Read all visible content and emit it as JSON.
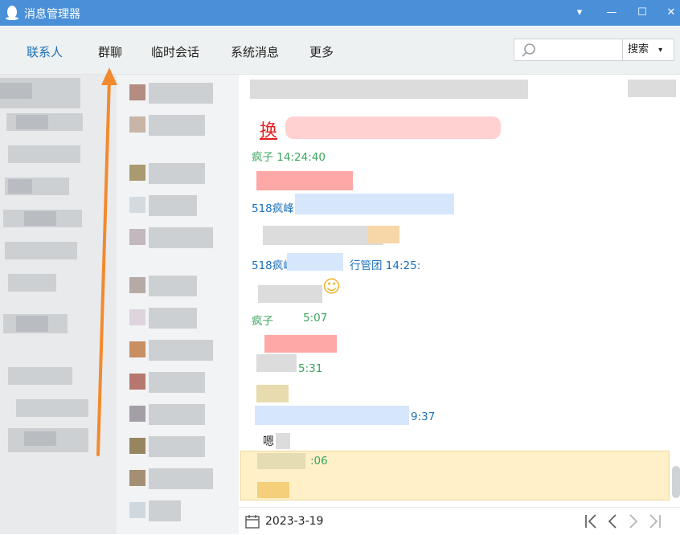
{
  "titlebar": {
    "title": "消息管理器",
    "minimize": "—",
    "maximize": "☐",
    "close": "✕",
    "menu": "▾"
  },
  "tabs": [
    {
      "label": "联系人"
    },
    {
      "label": "群聊"
    },
    {
      "label": "临时会话"
    },
    {
      "label": "系统消息"
    },
    {
      "label": "更多"
    }
  ],
  "search": {
    "placeholder": "",
    "button": "搜索",
    "button_arrow": "▾"
  },
  "messages": [
    {
      "sender": "疯子 14:24:40",
      "color": "#3aa55d"
    },
    {
      "sender": "518疯峰",
      "color": "#1b6fb8"
    },
    {
      "sender": "518疯峰",
      "suffix": "行管团 14:25:",
      "color": "#1b6fb8"
    },
    {
      "sender": "疯子",
      "suffix": "5:07",
      "color": "#3aa55d"
    },
    {
      "sender": "",
      "suffix": "5:31",
      "color": "#3aa55d"
    },
    {
      "sender": "",
      "suffix": "9:37",
      "color": "#1b6fb8"
    },
    {
      "sender": "",
      "suffix": ":06",
      "color": "#3aa55d"
    }
  ],
  "message_texts": {
    "line1_prefix": "换",
    "line2_prefix": "嗯"
  },
  "footer": {
    "date": "2023-3-19"
  },
  "icons": {
    "app": "qq-penguin-icon",
    "search": "search-icon",
    "calendar": "calendar-icon",
    "first": "first-page-icon",
    "prev": "prev-page-icon",
    "next": "next-page-icon",
    "last": "last-page-icon"
  },
  "colors": {
    "titlebar": "#4a90d9",
    "active_tab": "#1b6fb8",
    "highlight": "#fff0c8",
    "annotation_arrow": "#f28a2e"
  }
}
